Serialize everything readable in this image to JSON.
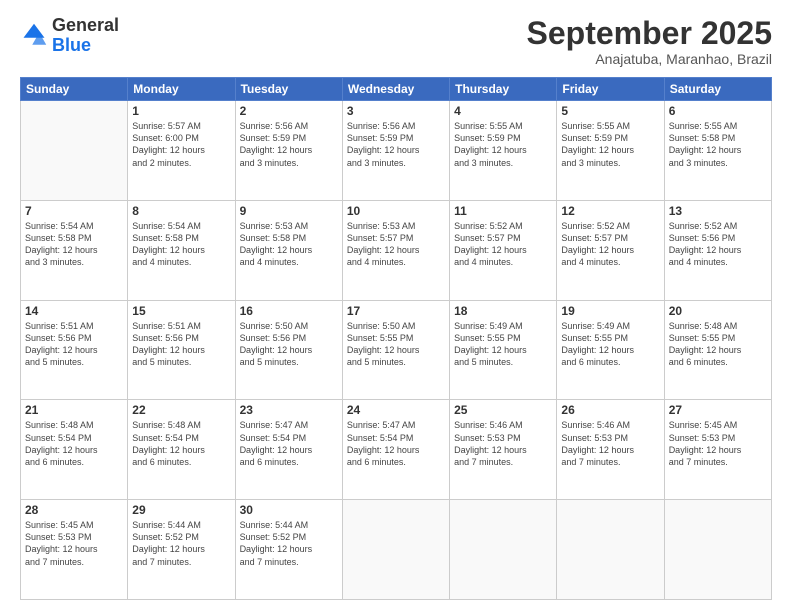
{
  "logo": {
    "line1": "General",
    "line2": "Blue"
  },
  "header": {
    "title": "September 2025",
    "subtitle": "Anajatuba, Maranhao, Brazil"
  },
  "days_of_week": [
    "Sunday",
    "Monday",
    "Tuesday",
    "Wednesday",
    "Thursday",
    "Friday",
    "Saturday"
  ],
  "weeks": [
    [
      {
        "day": "",
        "text": ""
      },
      {
        "day": "1",
        "text": "Sunrise: 5:57 AM\nSunset: 6:00 PM\nDaylight: 12 hours\nand 2 minutes."
      },
      {
        "day": "2",
        "text": "Sunrise: 5:56 AM\nSunset: 5:59 PM\nDaylight: 12 hours\nand 3 minutes."
      },
      {
        "day": "3",
        "text": "Sunrise: 5:56 AM\nSunset: 5:59 PM\nDaylight: 12 hours\nand 3 minutes."
      },
      {
        "day": "4",
        "text": "Sunrise: 5:55 AM\nSunset: 5:59 PM\nDaylight: 12 hours\nand 3 minutes."
      },
      {
        "day": "5",
        "text": "Sunrise: 5:55 AM\nSunset: 5:59 PM\nDaylight: 12 hours\nand 3 minutes."
      },
      {
        "day": "6",
        "text": "Sunrise: 5:55 AM\nSunset: 5:58 PM\nDaylight: 12 hours\nand 3 minutes."
      }
    ],
    [
      {
        "day": "7",
        "text": "Sunrise: 5:54 AM\nSunset: 5:58 PM\nDaylight: 12 hours\nand 3 minutes."
      },
      {
        "day": "8",
        "text": "Sunrise: 5:54 AM\nSunset: 5:58 PM\nDaylight: 12 hours\nand 4 minutes."
      },
      {
        "day": "9",
        "text": "Sunrise: 5:53 AM\nSunset: 5:58 PM\nDaylight: 12 hours\nand 4 minutes."
      },
      {
        "day": "10",
        "text": "Sunrise: 5:53 AM\nSunset: 5:57 PM\nDaylight: 12 hours\nand 4 minutes."
      },
      {
        "day": "11",
        "text": "Sunrise: 5:52 AM\nSunset: 5:57 PM\nDaylight: 12 hours\nand 4 minutes."
      },
      {
        "day": "12",
        "text": "Sunrise: 5:52 AM\nSunset: 5:57 PM\nDaylight: 12 hours\nand 4 minutes."
      },
      {
        "day": "13",
        "text": "Sunrise: 5:52 AM\nSunset: 5:56 PM\nDaylight: 12 hours\nand 4 minutes."
      }
    ],
    [
      {
        "day": "14",
        "text": "Sunrise: 5:51 AM\nSunset: 5:56 PM\nDaylight: 12 hours\nand 5 minutes."
      },
      {
        "day": "15",
        "text": "Sunrise: 5:51 AM\nSunset: 5:56 PM\nDaylight: 12 hours\nand 5 minutes."
      },
      {
        "day": "16",
        "text": "Sunrise: 5:50 AM\nSunset: 5:56 PM\nDaylight: 12 hours\nand 5 minutes."
      },
      {
        "day": "17",
        "text": "Sunrise: 5:50 AM\nSunset: 5:55 PM\nDaylight: 12 hours\nand 5 minutes."
      },
      {
        "day": "18",
        "text": "Sunrise: 5:49 AM\nSunset: 5:55 PM\nDaylight: 12 hours\nand 5 minutes."
      },
      {
        "day": "19",
        "text": "Sunrise: 5:49 AM\nSunset: 5:55 PM\nDaylight: 12 hours\nand 6 minutes."
      },
      {
        "day": "20",
        "text": "Sunrise: 5:48 AM\nSunset: 5:55 PM\nDaylight: 12 hours\nand 6 minutes."
      }
    ],
    [
      {
        "day": "21",
        "text": "Sunrise: 5:48 AM\nSunset: 5:54 PM\nDaylight: 12 hours\nand 6 minutes."
      },
      {
        "day": "22",
        "text": "Sunrise: 5:48 AM\nSunset: 5:54 PM\nDaylight: 12 hours\nand 6 minutes."
      },
      {
        "day": "23",
        "text": "Sunrise: 5:47 AM\nSunset: 5:54 PM\nDaylight: 12 hours\nand 6 minutes."
      },
      {
        "day": "24",
        "text": "Sunrise: 5:47 AM\nSunset: 5:54 PM\nDaylight: 12 hours\nand 6 minutes."
      },
      {
        "day": "25",
        "text": "Sunrise: 5:46 AM\nSunset: 5:53 PM\nDaylight: 12 hours\nand 7 minutes."
      },
      {
        "day": "26",
        "text": "Sunrise: 5:46 AM\nSunset: 5:53 PM\nDaylight: 12 hours\nand 7 minutes."
      },
      {
        "day": "27",
        "text": "Sunrise: 5:45 AM\nSunset: 5:53 PM\nDaylight: 12 hours\nand 7 minutes."
      }
    ],
    [
      {
        "day": "28",
        "text": "Sunrise: 5:45 AM\nSunset: 5:53 PM\nDaylight: 12 hours\nand 7 minutes."
      },
      {
        "day": "29",
        "text": "Sunrise: 5:44 AM\nSunset: 5:52 PM\nDaylight: 12 hours\nand 7 minutes."
      },
      {
        "day": "30",
        "text": "Sunrise: 5:44 AM\nSunset: 5:52 PM\nDaylight: 12 hours\nand 7 minutes."
      },
      {
        "day": "",
        "text": ""
      },
      {
        "day": "",
        "text": ""
      },
      {
        "day": "",
        "text": ""
      },
      {
        "day": "",
        "text": ""
      }
    ]
  ]
}
